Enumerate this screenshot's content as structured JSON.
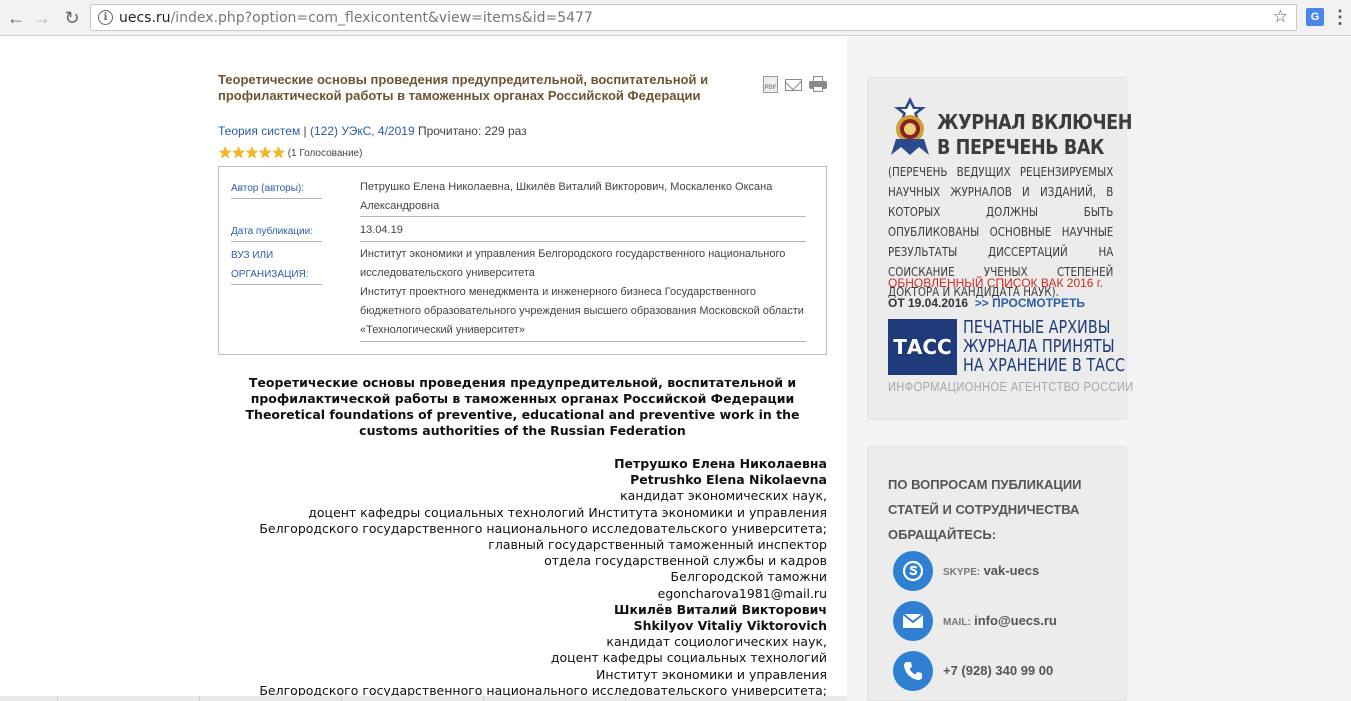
{
  "browser": {
    "url_host": "uecs.ru",
    "url_path": "/index.php?option=com_flexicontent&view=items&id=5477",
    "translate_label": "G"
  },
  "article": {
    "title": "Теоретические основы проведения предупредительной, воспитательной и профилактической работы в таможенных органах Российской Федерации",
    "meta_category": "Теория систем",
    "meta_separator": " | ",
    "meta_issue": "(122) УЭкС, 4/2019",
    "meta_read": " Прочитано: 229 раз",
    "rating_value": 5,
    "rating_max": 5,
    "votes": "(1 Голосование)",
    "info": {
      "author_label": "Автор (авторы):",
      "author_value": "Петрушко Елена Николаевна, Шкилёв Виталий Викторович, Москаленко Оксана Александровна",
      "date_label": "Дата публикации:",
      "date_value": "13.04.19",
      "org_label": "ВУЗ ИЛИ ОРГАНИЗАЦИЯ:",
      "org_value": "Институт экономики и управления Белгородского государственного национального исследовательского университета\nИнститут проектного менеджмента и инженерного бизнеса Государственного бюджетного образовательного учреждения высшего образования Московской области «Технологический университет»"
    },
    "body_title_ru": "Теоретические основы проведения предупредительной, воспитательной и профилактической работы в таможенных органах Российской Федерации",
    "body_title_en": "Theoretical foundations of preventive, educational and preventive work in the customs authorities of the Russian Federation",
    "authors_lines": [
      {
        "text": "Петрушко Елена Николаевна",
        "bold": true
      },
      {
        "text": "Petrushko Elena Nikolaevna",
        "bold": true
      },
      {
        "text": "кандидат экономических наук,",
        "bold": false
      },
      {
        "text": "доцент кафедры социальных технологий Института экономики и управления",
        "bold": false
      },
      {
        "text": "Белгородского государственного национального исследовательского университета; ",
        "bold": false
      },
      {
        "text": "главный государственный таможенный инспектор ",
        "bold": false
      },
      {
        "text": "отдела государственной службы и кадров",
        "bold": false
      },
      {
        "text": "Белгородской таможни",
        "bold": false
      },
      {
        "text": "egoncharova1981@mail.ru",
        "bold": false
      },
      {
        "text": "Шкилёв Виталий Викторович",
        "bold": true
      },
      {
        "text": "Shkilyov Vitaliy Viktorovich",
        "bold": true
      },
      {
        "text": "кандидат социологических наук,",
        "bold": false
      },
      {
        "text": "доцент кафедры социальных технологий",
        "bold": false
      },
      {
        "text": "Институт экономики и управления ",
        "bold": false
      },
      {
        "text": "Белгородского государственного национального исследовательского университета;",
        "bold": false
      }
    ]
  },
  "sidebar": {
    "vak_heading_1": "ЖУРНАЛ ВКЛЮЧЕН",
    "vak_heading_2": "В ПЕРЕЧЕНЬ ВАК",
    "vak_description": "(ПЕРЕЧЕНЬ ВЕДУЩИХ РЕЦЕНЗИРУЕМЫХ НАУЧНЫХ ЖУРНАЛОВ И ИЗДАНИЙ, В КОТОРЫХ ДОЛЖНЫ БЫТЬ ОПУБЛИКОВАНЫ ОСНОВНЫЕ НАУЧНЫЕ РЕЗУЛЬТАТЫ ДИССЕРТАЦИЙ НА СОИСКАНИЕ УЧЕНЫХ СТЕПЕНЕЙ ДОКТОРА И КАНДИДАТА НАУК).",
    "vak_updated": "ОБНОВЛЕННЫЙ СПИСОК ВАК 2016 г.",
    "vak_from": "ОТ 19.04.2016",
    "vak_link": ">> ПРОСМОТРЕТЬ",
    "tass_logo": "ТАСС",
    "tass_line_1": "ПЕЧАТНЫЕ АРХИВЫ",
    "tass_line_2": "ЖУРНАЛА ПРИНЯТЫ",
    "tass_line_3": "НА ХРАНЕНИЕ В ТАСС",
    "tass_sub": "ИНФОРМАЦИОННОЕ АГЕНТСТВО РОССИИ",
    "contact_heading": "ПО ВОПРОСАМ ПУБЛИКАЦИИ СТАТЕЙ И СОТРУДНИЧЕСТВА ОБРАЩАЙТЕСЬ:",
    "skype_key": "SKYPE:",
    "skype_value": "vak-uecs",
    "mail_key": "MAIL:",
    "mail_value": "info@uecs.ru",
    "phone_value": "+7 (928) 340 99 00"
  },
  "colors": {
    "title_brown": "#6b5634",
    "link_blue": "#2a5fa8",
    "tass_blue": "#1f3a7a",
    "update_red": "#d22a20",
    "icon_blue": "#2f7fd2",
    "star_gold": "#f2b81c"
  }
}
